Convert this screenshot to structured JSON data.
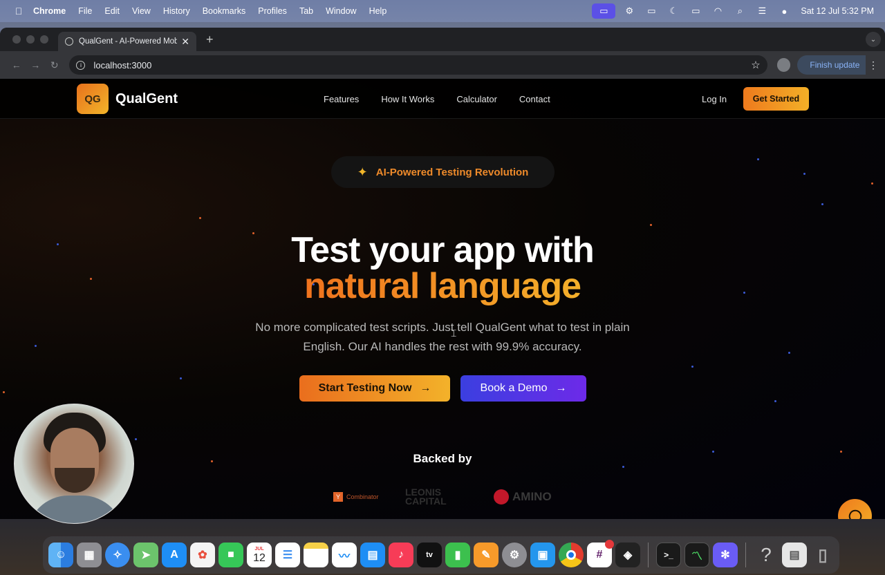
{
  "menubar": {
    "app_name": "Chrome",
    "items": [
      "File",
      "Edit",
      "View",
      "History",
      "Bookmarks",
      "Profiles",
      "Tab",
      "Window",
      "Help"
    ],
    "clock": "Sat 12 Jul  5:32 PM"
  },
  "browser": {
    "tab_title": "QualGent - AI-Powered Mobil",
    "url": "localhost:3000",
    "finish_update_label": "Finish update"
  },
  "site": {
    "logo_mark": "QG",
    "logo_text": "QualGent",
    "nav_links": [
      "Features",
      "How It Works",
      "Calculator",
      "Contact"
    ],
    "login_label": "Log In",
    "get_started_label": "Get Started",
    "badge_text": "AI-Powered Testing Revolution",
    "headline_line1": "Test your app with",
    "headline_line2": "natural language",
    "subtext": "No more complicated test scripts. Just tell QualGent what to test in plain English. Our AI handles the rest with 99.9% accuracy.",
    "primary_cta": "Start Testing Now",
    "secondary_cta": "Book a Demo",
    "arrow": "→",
    "backed_by": "Backed by",
    "backers": {
      "yc_mark": "Y",
      "yc_name": "Combinator",
      "leonis": "LEONIS CAPITAL",
      "amino": "AMINO"
    }
  },
  "dock": {
    "calendar_month": "JUL",
    "calendar_day": "12"
  },
  "colors": {
    "accent_orange": "#ee7a1d",
    "accent_yellow": "#f3b027",
    "accent_indigo": "#3b3fe0"
  }
}
